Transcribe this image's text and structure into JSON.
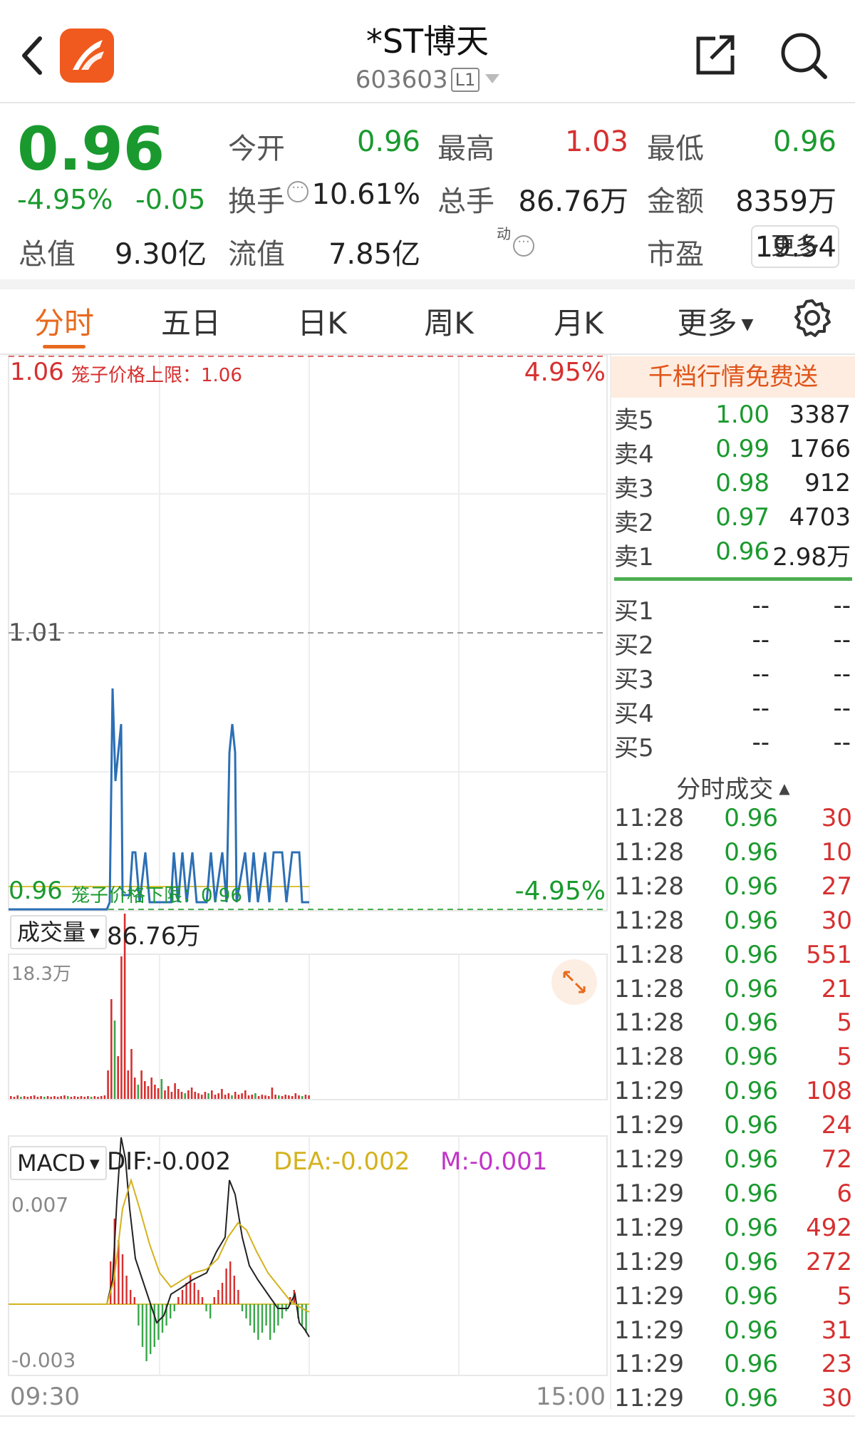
{
  "header": {
    "title": "*ST博天",
    "code": "603603",
    "level": "L1"
  },
  "quote": {
    "price": "0.96",
    "change_pct": "-4.95%",
    "change_amt": "-0.05",
    "stats": [
      {
        "label": "今开",
        "value": "0.96",
        "color": "#1a9a2e"
      },
      {
        "label": "最高",
        "value": "1.03",
        "color": "#d63030"
      },
      {
        "label": "最低",
        "value": "0.96",
        "color": "#1a9a2e"
      },
      {
        "label": "换手",
        "value": "10.61%",
        "color": "#222222"
      },
      {
        "label": "总手",
        "value": "86.76万",
        "color": "#222222"
      },
      {
        "label": "金额",
        "value": "8359万",
        "color": "#222222"
      },
      {
        "label": "总值",
        "value": "9.30亿",
        "color": "#222222"
      },
      {
        "label": "流值",
        "value": "7.85亿",
        "color": "#222222"
      },
      {
        "label": "市盈",
        "value": "19.54",
        "color": "#222222"
      }
    ],
    "pe_superscript": "动",
    "more_label": "更多"
  },
  "tabs": [
    "分时",
    "五日",
    "日K",
    "周K",
    "月K",
    "更多"
  ],
  "chart": {
    "upper_price": "1.06",
    "upper_label": "笼子价格上限：1.06",
    "upper_pct": "4.95%",
    "mid_price": "1.01",
    "lower_price": "0.96",
    "lower_label": "笼子价格下限：0.96",
    "lower_pct": "-4.95%",
    "volume_label": "成交量",
    "volume_total": "86.76万",
    "volume_max": "18.3万",
    "macd_label": "MACD",
    "dif": "DIF:-0.002",
    "dea": "DEA:-0.002",
    "m": "M:-0.001",
    "macd_max": "0.007",
    "macd_min": "-0.003",
    "time_start": "09:30",
    "time_end": "15:00"
  },
  "chart_data": {
    "type": "line",
    "x_range": [
      "09:30",
      "15:00"
    ],
    "ylim": [
      0.96,
      1.06
    ],
    "price_series_note": "",
    "volume_max": 183000,
    "macd_range": [
      -0.003,
      0.007
    ]
  },
  "orderbook": {
    "banner": "千档行情免费送",
    "asks": [
      {
        "label": "卖5",
        "price": "1.00",
        "vol": "3387"
      },
      {
        "label": "卖4",
        "price": "0.99",
        "vol": "1766"
      },
      {
        "label": "卖3",
        "price": "0.98",
        "vol": "912"
      },
      {
        "label": "卖2",
        "price": "0.97",
        "vol": "4703"
      },
      {
        "label": "卖1",
        "price": "0.96",
        "vol": "2.98万"
      }
    ],
    "bids": [
      {
        "label": "买1",
        "price": "--",
        "vol": "--"
      },
      {
        "label": "买2",
        "price": "--",
        "vol": "--"
      },
      {
        "label": "买3",
        "price": "--",
        "vol": "--"
      },
      {
        "label": "买4",
        "price": "--",
        "vol": "--"
      },
      {
        "label": "买5",
        "price": "--",
        "vol": "--"
      }
    ]
  },
  "trades": {
    "title": "分时成交",
    "rows": [
      {
        "time": "11:28",
        "price": "0.96",
        "vol": "30"
      },
      {
        "time": "11:28",
        "price": "0.96",
        "vol": "10"
      },
      {
        "time": "11:28",
        "price": "0.96",
        "vol": "27"
      },
      {
        "time": "11:28",
        "price": "0.96",
        "vol": "30"
      },
      {
        "time": "11:28",
        "price": "0.96",
        "vol": "551"
      },
      {
        "time": "11:28",
        "price": "0.96",
        "vol": "21"
      },
      {
        "time": "11:28",
        "price": "0.96",
        "vol": "5"
      },
      {
        "time": "11:28",
        "price": "0.96",
        "vol": "5"
      },
      {
        "time": "11:29",
        "price": "0.96",
        "vol": "108"
      },
      {
        "time": "11:29",
        "price": "0.96",
        "vol": "24"
      },
      {
        "time": "11:29",
        "price": "0.96",
        "vol": "72"
      },
      {
        "time": "11:29",
        "price": "0.96",
        "vol": "6"
      },
      {
        "time": "11:29",
        "price": "0.96",
        "vol": "492"
      },
      {
        "time": "11:29",
        "price": "0.96",
        "vol": "272"
      },
      {
        "time": "11:29",
        "price": "0.96",
        "vol": "5"
      },
      {
        "time": "11:29",
        "price": "0.96",
        "vol": "31"
      },
      {
        "time": "11:29",
        "price": "0.96",
        "vol": "23"
      },
      {
        "time": "11:29",
        "price": "0.96",
        "vol": "30"
      }
    ]
  }
}
